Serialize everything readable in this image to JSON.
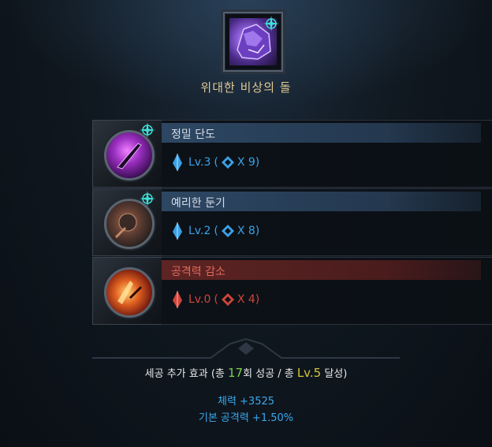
{
  "item": {
    "name": "위대한 비상의 돌",
    "icon": "purple-stone-icon"
  },
  "gems": [
    {
      "name": "정밀 단도",
      "icon": "precision-dagger-icon",
      "level": "Lv.3",
      "rank_icon": "blue-diamond-icon",
      "count": "X 9",
      "color": "#3aa2e8",
      "badge": "cyan-compass-icon"
    },
    {
      "name": "예리한 둔기",
      "icon": "sharp-blunt-icon",
      "level": "Lv.2",
      "rank_icon": "blue-diamond-icon",
      "count": "X 8",
      "color": "#3aa2e8",
      "badge": "cyan-compass-icon"
    },
    {
      "name": "공격력 감소",
      "icon": "attack-reduction-icon",
      "level": "Lv.0",
      "rank_icon": "red-diamond-icon",
      "count": "X 4",
      "color": "#d0453b"
    }
  ],
  "summary": {
    "prefix": "세공 추가 효과 (총 ",
    "total_count": "17",
    "mid": "회 성공 / 총 ",
    "total_level": "Lv.5",
    "suffix": " 달성)",
    "stats": [
      "체력 +3525",
      "기본 공격력 +1.50%"
    ]
  },
  "colors": {
    "blue": "#3aa2e8",
    "red": "#d0453b",
    "title_gold": "#e0c894",
    "green": "#7bd04a",
    "yellow": "#d4c43a"
  }
}
